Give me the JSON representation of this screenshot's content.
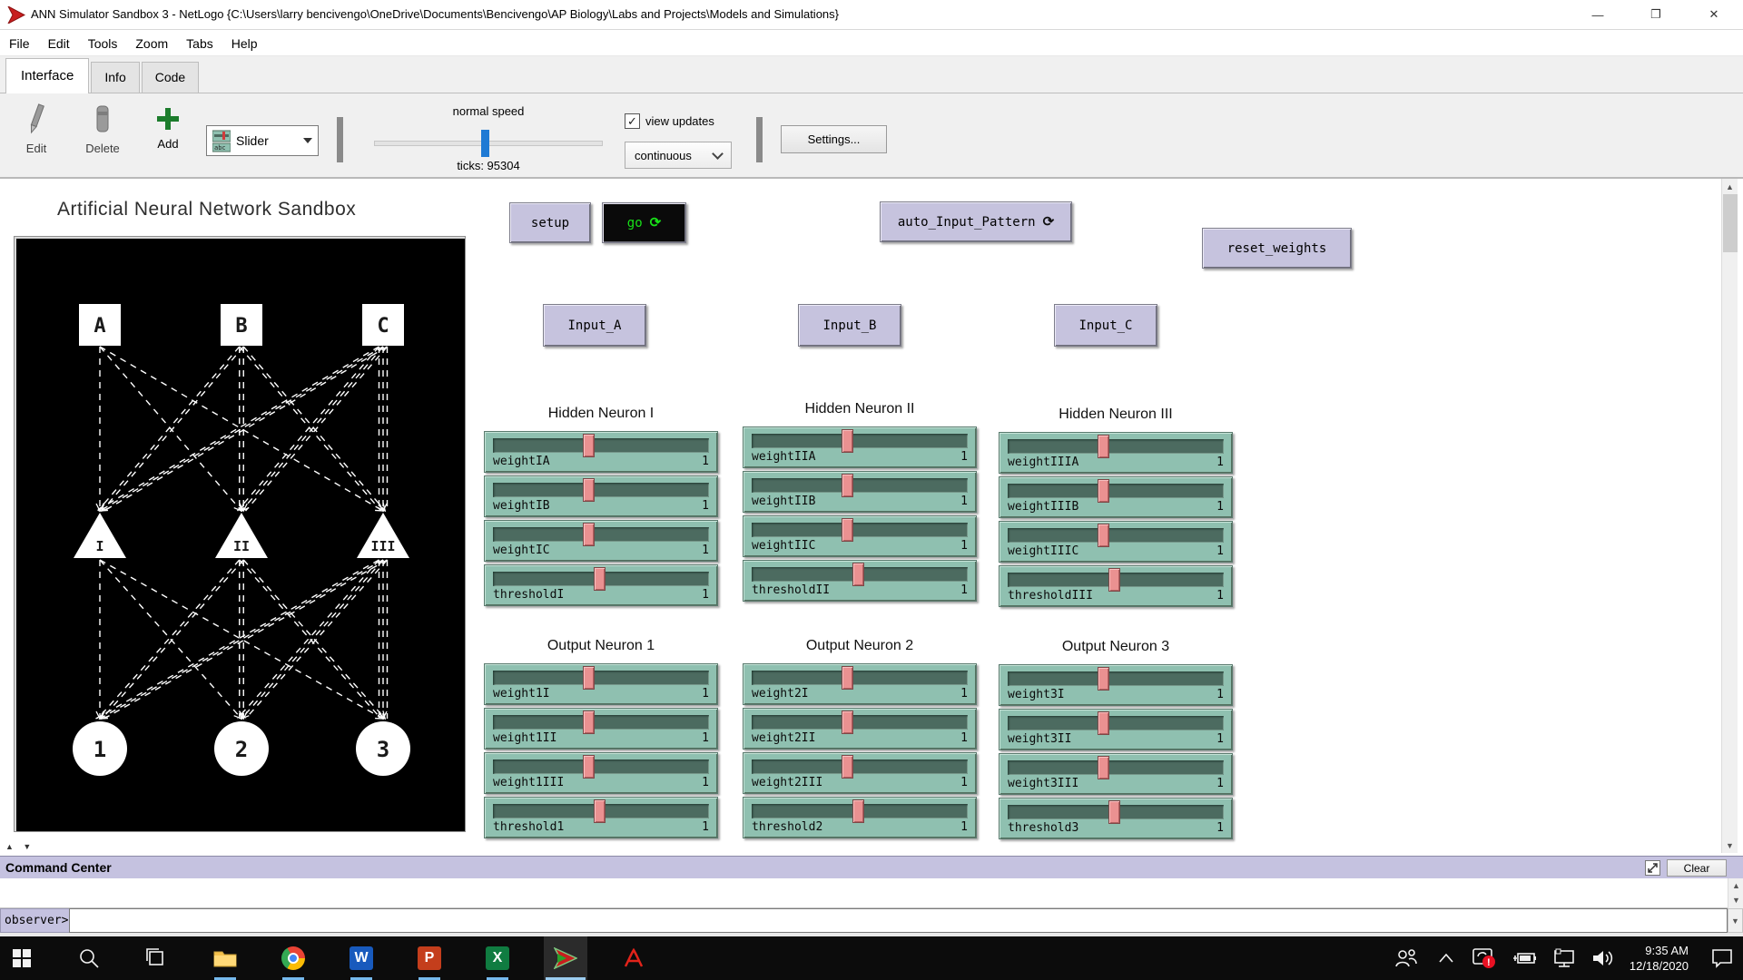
{
  "window": {
    "title": "ANN Simulator Sandbox 3 - NetLogo {C:\\Users\\larry bencivengo\\OneDrive\\Documents\\Bencivengo\\AP Biology\\Labs and Projects\\Models and Simulations}",
    "minimize": "—",
    "maximize": "❐",
    "close": "✕"
  },
  "menu": {
    "items": [
      "File",
      "Edit",
      "Tools",
      "Zoom",
      "Tabs",
      "Help"
    ]
  },
  "tabs": {
    "interface": "Interface",
    "info": "Info",
    "code": "Code"
  },
  "toolbar": {
    "edit": "Edit",
    "delete": "Delete",
    "add": "Add",
    "widget_chooser": "Slider",
    "speed_label": "normal speed",
    "ticks": "ticks: 95304",
    "view_updates": "view updates",
    "update_mode": "continuous",
    "settings": "Settings..."
  },
  "view": {
    "title": "Artificial Neural Network Sandbox",
    "inputs": [
      "A",
      "B",
      "C"
    ],
    "hidden": [
      "I",
      "II",
      "III"
    ],
    "outputs": [
      "1",
      "2",
      "3"
    ]
  },
  "buttons": {
    "setup": "setup",
    "go": "go",
    "go_forever_icon": "⟳",
    "auto_pattern": "auto_Input_Pattern",
    "auto_forever_icon": "⟳",
    "reset_weights": "reset_weights",
    "input_a": "Input_A",
    "input_b": "Input_B",
    "input_c": "Input_C"
  },
  "slider_groups": [
    {
      "title": "Hidden Neuron I",
      "sliders": [
        {
          "label": "weightIA",
          "value": "1"
        },
        {
          "label": "weightIB",
          "value": "1"
        },
        {
          "label": "weightIC",
          "value": "1"
        },
        {
          "label": "thresholdI",
          "value": "1"
        }
      ]
    },
    {
      "title": "Hidden Neuron II",
      "sliders": [
        {
          "label": "weightIIA",
          "value": "1"
        },
        {
          "label": "weightIIB",
          "value": "1"
        },
        {
          "label": "weightIIC",
          "value": "1"
        },
        {
          "label": "thresholdII",
          "value": "1"
        }
      ]
    },
    {
      "title": "Hidden Neuron III",
      "sliders": [
        {
          "label": "weightIIIA",
          "value": "1"
        },
        {
          "label": "weightIIIB",
          "value": "1"
        },
        {
          "label": "weightIIIC",
          "value": "1"
        },
        {
          "label": "thresholdIII",
          "value": "1"
        }
      ]
    },
    {
      "title": "Output Neuron 1",
      "sliders": [
        {
          "label": "weight1I",
          "value": "1"
        },
        {
          "label": "weight1II",
          "value": "1"
        },
        {
          "label": "weight1III",
          "value": "1"
        },
        {
          "label": "threshold1",
          "value": "1"
        }
      ]
    },
    {
      "title": "Output Neuron 2",
      "sliders": [
        {
          "label": "weight2I",
          "value": "1"
        },
        {
          "label": "weight2II",
          "value": "1"
        },
        {
          "label": "weight2III",
          "value": "1"
        },
        {
          "label": "threshold2",
          "value": "1"
        }
      ]
    },
    {
      "title": "Output Neuron 3",
      "sliders": [
        {
          "label": "weight3I",
          "value": "1"
        },
        {
          "label": "weight3II",
          "value": "1"
        },
        {
          "label": "weight3III",
          "value": "1"
        },
        {
          "label": "threshold3",
          "value": "1"
        }
      ]
    }
  ],
  "command_center": {
    "title": "Command Center",
    "clear": "Clear",
    "prompt": "observer>"
  },
  "taskbar": {
    "time": "9:35 AM",
    "date": "12/18/2020"
  },
  "colors": {
    "widget_lavender": "#c6c3de",
    "slider_teal": "#8fc0b0",
    "slider_track": "#4c6b60",
    "slider_handle": "#ea9191",
    "go_green": "#18e018",
    "speed_blue": "#1f7ad4",
    "run_indicator": "#76b9ed"
  }
}
